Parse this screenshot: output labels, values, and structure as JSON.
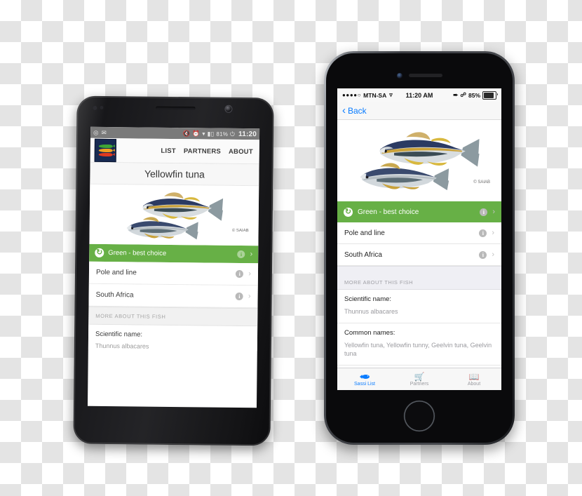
{
  "scene": {
    "background": "transparent-checkerboard",
    "devices": [
      "android-phone",
      "iphone"
    ]
  },
  "android": {
    "status_bar": {
      "icons": [
        "location-icon",
        "gmail-icon",
        "mute-icon",
        "alarm-icon",
        "wifi-icon",
        "signal-icon"
      ],
      "battery_percent": "81%",
      "time": "11:20"
    },
    "app_bar": {
      "logo_name": "sassi-logo",
      "logo_fish_colors": [
        "#3fa535",
        "#f0a020",
        "#e03a20"
      ],
      "logo_bg": "#172a52",
      "nav": [
        {
          "label": "LIST"
        },
        {
          "label": "PARTNERS"
        },
        {
          "label": "ABOUT"
        }
      ]
    },
    "title": "Yellowfin tuna",
    "hero": {
      "credit": "© SAIAB",
      "alt": "yellowfin-tuna-illustration"
    },
    "rows": [
      {
        "label": "Green - best choice",
        "type": "status",
        "accent": "#67b046",
        "icon": "recycle-icon",
        "info": "i",
        "chevron": "›"
      },
      {
        "label": "Pole and line",
        "type": "plain",
        "info": "i",
        "chevron": "›"
      },
      {
        "label": "South Africa",
        "type": "plain",
        "info": "i",
        "chevron": "›"
      }
    ],
    "section_header": "MORE ABOUT THIS FISH",
    "details": [
      {
        "key": "Scientific name:",
        "value": "Thunnus albacares"
      }
    ]
  },
  "iphone": {
    "status_bar": {
      "signal_dots": "●●●●○",
      "carrier": "MTN-SA",
      "wifi_icon": "wifi-icon",
      "time": "11:20 AM",
      "location_icon": "location-arrow-icon",
      "bluetooth_icon": "bluetooth-icon",
      "battery_percent": "85%",
      "battery_level": 85
    },
    "nav_bar": {
      "back_label": "Back",
      "back_icon": "chevron-left-icon"
    },
    "hero": {
      "credit": "© SAIAB",
      "alt": "yellowfin-tuna-illustration"
    },
    "rows": [
      {
        "label": "Green - best choice",
        "type": "status",
        "accent": "#67b046",
        "icon": "recycle-icon",
        "info": "i",
        "chevron": "›"
      },
      {
        "label": "Pole and line",
        "type": "plain",
        "info": "i",
        "chevron": "›"
      },
      {
        "label": "South Africa",
        "type": "plain",
        "info": "i",
        "chevron": "›"
      }
    ],
    "section_header": "MORE ABOUT THIS FISH",
    "details": [
      {
        "key": "Scientific name:",
        "value": "Thunnus albacares"
      },
      {
        "key": "Common names:",
        "value": "Yellowfin tuna, Yellowfin tunny, Geelvin tuna, Geelvin tuna"
      }
    ],
    "tab_bar": [
      {
        "label": "Sassi List",
        "icon": "fish-icon",
        "active": true
      },
      {
        "label": "Partners",
        "icon": "cart-icon",
        "active": false
      },
      {
        "label": "About",
        "icon": "book-icon",
        "active": false
      }
    ]
  },
  "colors": {
    "green_accent": "#67b046",
    "ios_blue": "#0a7cff",
    "logo_navy": "#172a52",
    "android_statusbar": "#7a7a7a"
  }
}
